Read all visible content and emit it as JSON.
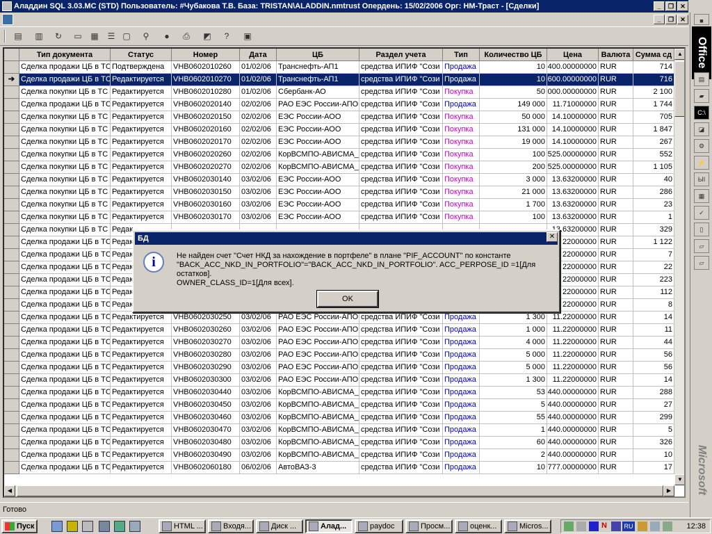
{
  "window": {
    "title": "Аладдин SQL 3.03.MC (STD)  Пользователь: #Чубакова Т.В. База: TRISTAN\\ALADDIN.nmtrust Опердень: 15/02/2006 Орг: НМ-Траст - [Сделки]"
  },
  "toolbar": {
    "icons": [
      "document-icon",
      "delete-icon",
      "refresh-icon",
      "view-icon",
      "grid-icon",
      "list-icon",
      "window-icon",
      "find-icon",
      "lock-icon",
      "print-icon",
      "export-icon",
      "help-icon",
      "run-icon"
    ]
  },
  "grid": {
    "columns": [
      "Тип документа",
      "Статус",
      "Номер",
      "Дата",
      "ЦБ",
      "Раздел учета",
      "Тип",
      "Количество ЦБ",
      "Цена",
      "Валюта",
      "Сумма сд"
    ],
    "selected_index": 1,
    "rows": [
      [
        "Сделка продажи ЦБ в ТС",
        "Подтверждена",
        "VHB0602010260",
        "01/02/06",
        "Транснефть-АП1",
        "средства ИПИФ \"Сози",
        "Продажа",
        "10",
        "400.00000000",
        "RUR",
        "714"
      ],
      [
        "Сделка продажи ЦБ в ТС",
        "Редактируется",
        "VHB0602010270",
        "01/02/06",
        "Транснефть-АП1",
        "средства ИПИФ \"Сози",
        "Продажа",
        "10",
        "600.00000000",
        "RUR",
        "716"
      ],
      [
        "Сделка покупки ЦБ в ТС",
        "Редактируется",
        "VHB0602010280",
        "01/02/06",
        "Сбербанк-АО",
        "средства ИПИФ \"Сози",
        "Покупка",
        "50",
        "000.00000000",
        "RUR",
        "2 100"
      ],
      [
        "Сделка продажи ЦБ в ТС",
        "Редактируется",
        "VHB0602020140",
        "02/02/06",
        "РАО ЕЭС России-АПО",
        "средства ИПИФ \"Сози",
        "Продажа",
        "149 000",
        "11.71000000",
        "RUR",
        "1 744"
      ],
      [
        "Сделка покупки ЦБ в ТС",
        "Редактируется",
        "VHB0602020150",
        "02/02/06",
        "ЕЭС России-АОО",
        "средства ИПИФ \"Сози",
        "Покупка",
        "50 000",
        "14.10000000",
        "RUR",
        "705"
      ],
      [
        "Сделка покупки ЦБ в ТС",
        "Редактируется",
        "VHB0602020160",
        "02/02/06",
        "ЕЭС России-АОО",
        "средства ИПИФ \"Сози",
        "Покупка",
        "131 000",
        "14.10000000",
        "RUR",
        "1 847"
      ],
      [
        "Сделка покупки ЦБ в ТС",
        "Редактируется",
        "VHB0602020170",
        "02/02/06",
        "ЕЭС России-АОО",
        "средства ИПИФ \"Сози",
        "Покупка",
        "19 000",
        "14.10000000",
        "RUR",
        "267"
      ],
      [
        "Сделка покупки ЦБ в ТС",
        "Редактируется",
        "VHB0602020260",
        "02/02/06",
        "КорВСМПО-АВИСМА_А",
        "средства ИПИФ \"Сози",
        "Покупка",
        "100",
        "525.00000000",
        "RUR",
        "552"
      ],
      [
        "Сделка покупки ЦБ в ТС",
        "Редактируется",
        "VHB0602020270",
        "02/02/06",
        "КорВСМПО-АВИСМА_А",
        "средства ИПИФ \"Сози",
        "Покупка",
        "200",
        "525.00000000",
        "RUR",
        "1 105"
      ],
      [
        "Сделка покупки ЦБ в ТС",
        "Редактируется",
        "VHB0602030140",
        "03/02/06",
        "ЕЭС России-АОО",
        "средства ИПИФ \"Сози",
        "Покупка",
        "3 000",
        "13.63200000",
        "RUR",
        "40"
      ],
      [
        "Сделка покупки ЦБ в ТС",
        "Редактируется",
        "VHB0602030150",
        "03/02/06",
        "ЕЭС России-АОО",
        "средства ИПИФ \"Сози",
        "Покупка",
        "21 000",
        "13.63200000",
        "RUR",
        "286"
      ],
      [
        "Сделка покупки ЦБ в ТС",
        "Редактируется",
        "VHB0602030160",
        "03/02/06",
        "ЕЭС России-АОО",
        "средства ИПИФ \"Сози",
        "Покупка",
        "1 700",
        "13.63200000",
        "RUR",
        "23"
      ],
      [
        "Сделка покупки ЦБ в ТС",
        "Редактируется",
        "VHB0602030170",
        "03/02/06",
        "ЕЭС России-АОО",
        "средства ИПИФ \"Сози",
        "Покупка",
        "100",
        "13.63200000",
        "RUR",
        "1"
      ],
      [
        "Сделка покупки ЦБ в ТС",
        "Редак",
        "",
        "",
        "",
        "",
        "",
        "",
        "13.63200000",
        "RUR",
        "329"
      ],
      [
        "Сделка продажи ЦБ в ТС",
        "Редак",
        "",
        "",
        "",
        "",
        "",
        "",
        "22000000",
        "RUR",
        "1 122"
      ],
      [
        "Сделка продажи ЦБ в ТС",
        "Редак",
        "",
        "",
        "",
        "",
        "",
        "",
        "22000000",
        "RUR",
        "7"
      ],
      [
        "Сделка продажи ЦБ в ТС",
        "Редак",
        "",
        "",
        "",
        "",
        "",
        "",
        "22000000",
        "RUR",
        "22"
      ],
      [
        "Сделка продажи ЦБ в ТС",
        "Редак",
        "",
        "",
        "",
        "",
        "",
        "",
        "22000000",
        "RUR",
        "223"
      ],
      [
        "Сделка продажи ЦБ в ТС",
        "Редак",
        "",
        "",
        "",
        "",
        "",
        "",
        "22000000",
        "RUR",
        "112"
      ],
      [
        "Сделка продажи ЦБ в ТС",
        "Редак",
        "",
        "",
        "",
        "",
        "",
        "",
        "22000000",
        "RUR",
        "8"
      ],
      [
        "Сделка продажи ЦБ в ТС",
        "Редактируется",
        "VHB0602030250",
        "03/02/06",
        "РАО ЕЭС России-АПО",
        "средства ИПИФ \"Сози",
        "Продажа",
        "1 300",
        "11.22000000",
        "RUR",
        "14"
      ],
      [
        "Сделка продажи ЦБ в ТС",
        "Редактируется",
        "VHB0602030260",
        "03/02/06",
        "РАО ЕЭС России-АПО",
        "средства ИПИФ \"Сози",
        "Продажа",
        "1 000",
        "11.22000000",
        "RUR",
        "11"
      ],
      [
        "Сделка продажи ЦБ в ТС",
        "Редактируется",
        "VHB0602030270",
        "03/02/06",
        "РАО ЕЭС России-АПО",
        "средства ИПИФ \"Сози",
        "Продажа",
        "4 000",
        "11.22000000",
        "RUR",
        "44"
      ],
      [
        "Сделка продажи ЦБ в ТС",
        "Редактируется",
        "VHB0602030280",
        "03/02/06",
        "РАО ЕЭС России-АПО",
        "средства ИПИФ \"Сози",
        "Продажа",
        "5 000",
        "11.22000000",
        "RUR",
        "56"
      ],
      [
        "Сделка продажи ЦБ в ТС",
        "Редактируется",
        "VHB0602030290",
        "03/02/06",
        "РАО ЕЭС России-АПО",
        "средства ИПИФ \"Сози",
        "Продажа",
        "5 000",
        "11.22000000",
        "RUR",
        "56"
      ],
      [
        "Сделка продажи ЦБ в ТС",
        "Редактируется",
        "VHB0602030300",
        "03/02/06",
        "РАО ЕЭС России-АПО",
        "средства ИПИФ \"Сози",
        "Продажа",
        "1 300",
        "11.22000000",
        "RUR",
        "14"
      ],
      [
        "Сделка продажи ЦБ в ТС",
        "Редактируется",
        "VHB0602030440",
        "03/02/06",
        "КорВСМПО-АВИСМА_А",
        "средства ИПИФ \"Сози",
        "Продажа",
        "53",
        "440.00000000",
        "RUR",
        "288"
      ],
      [
        "Сделка продажи ЦБ в ТС",
        "Редактируется",
        "VHB0602030450",
        "03/02/06",
        "КорВСМПО-АВИСМА_А",
        "средства ИПИФ \"Сози",
        "Продажа",
        "5",
        "440.00000000",
        "RUR",
        "27"
      ],
      [
        "Сделка продажи ЦБ в ТС",
        "Редактируется",
        "VHB0602030460",
        "03/02/06",
        "КорВСМПО-АВИСМА_А",
        "средства ИПИФ \"Сози",
        "Продажа",
        "55",
        "440.00000000",
        "RUR",
        "299"
      ],
      [
        "Сделка продажи ЦБ в ТС",
        "Редактируется",
        "VHB0602030470",
        "03/02/06",
        "КорВСМПО-АВИСМА_А",
        "средства ИПИФ \"Сози",
        "Продажа",
        "1",
        "440.00000000",
        "RUR",
        "5"
      ],
      [
        "Сделка продажи ЦБ в ТС",
        "Редактируется",
        "VHB0602030480",
        "03/02/06",
        "КорВСМПО-АВИСМА_А",
        "средства ИПИФ \"Сози",
        "Продажа",
        "60",
        "440.00000000",
        "RUR",
        "326"
      ],
      [
        "Сделка продажи ЦБ в ТС",
        "Редактируется",
        "VHB0602030490",
        "03/02/06",
        "КорВСМПО-АВИСМА_А",
        "средства ИПИФ \"Сози",
        "Продажа",
        "2",
        "440.00000000",
        "RUR",
        "10"
      ],
      [
        "Сделка продажи ЦБ в ТС",
        "Редактируется",
        "VHB0602060180",
        "06/02/06",
        "АвтоВАЗ-3",
        "средства ИПИФ \"Сози",
        "Продажа",
        "10",
        "777.00000000",
        "RUR",
        "17"
      ]
    ]
  },
  "colors": {
    "sale": "#0000cc",
    "purchase": "#cc00cc",
    "selection": "#0a246a"
  },
  "status": "Готово",
  "dialog": {
    "title": "БД",
    "message_line1": "Не найден счет \"Счет НКД за нахождение в портфеле\" в плане \"PIF_ACCOUNT\" по константе",
    "message_line2": "\"BACK_ACC_NKD_IN_PORTFOLIO\"=\"BACK_ACC_NKD_IN_PORTFOLIO\". ACC_PERPOSE_ID =1[Для остатков].",
    "message_line3": "OWNER_CLASS_ID=1[Для всех].",
    "ok_label": "OK"
  },
  "office": {
    "label": "Office",
    "brand": "Microsoft"
  },
  "taskbar": {
    "start": "Пуск",
    "tasks": [
      "HTML ...",
      "Входя...",
      "Диск ...",
      "Алад...",
      "paydoc",
      "Просм...",
      "оценк...",
      "Micros..."
    ],
    "active_index": 3,
    "lang": "RU",
    "clock": "12:38"
  }
}
